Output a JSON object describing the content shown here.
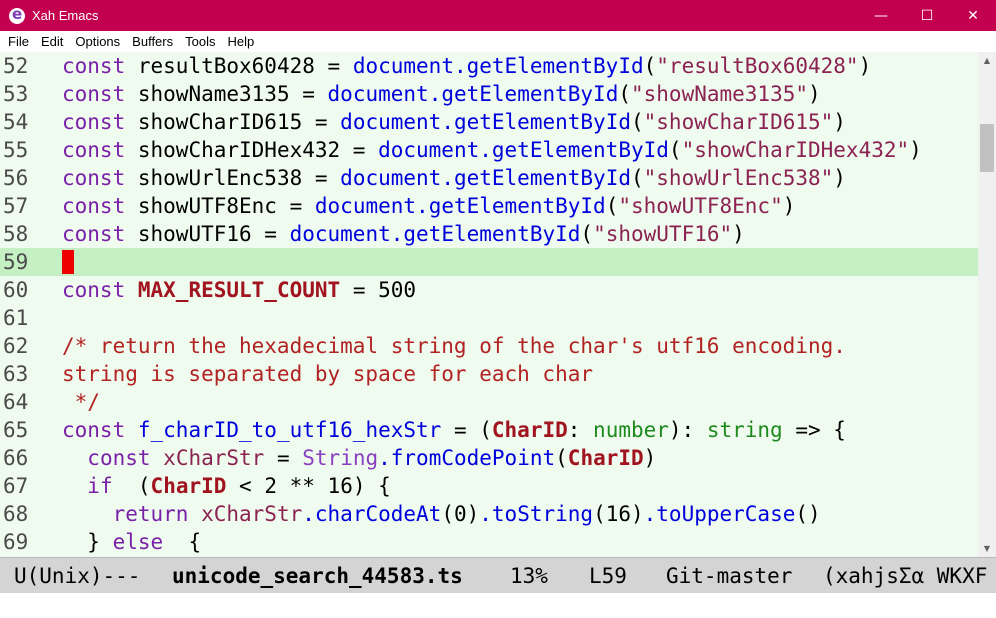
{
  "window": {
    "title": "Xah Emacs",
    "minimize_glyph": "—",
    "maximize_glyph": "☐",
    "close_glyph": "✕",
    "icon": "emacs-icon"
  },
  "menu": [
    "File",
    "Edit",
    "Options",
    "Buffers",
    "Tools",
    "Help"
  ],
  "editor": {
    "lines": [
      {
        "n": "52",
        "tokens": [
          [
            "kw",
            "const"
          ],
          [
            "",
            "resultBox60428 = "
          ],
          [
            "fn",
            "document"
          ],
          [
            "",
            ""
          ],
          [
            "fn",
            ".getElementById"
          ],
          [
            "",
            "("
          ],
          [
            "str",
            "\"resultBox60428\""
          ],
          [
            "",
            ")"
          ]
        ]
      },
      {
        "n": "53",
        "tokens": [
          [
            "kw",
            "const"
          ],
          [
            "",
            "showName3135 = "
          ],
          [
            "fn",
            "document"
          ],
          [
            "fn",
            ".getElementById"
          ],
          [
            "",
            "("
          ],
          [
            "str",
            "\"showName3135\""
          ],
          [
            "",
            ")"
          ]
        ]
      },
      {
        "n": "54",
        "tokens": [
          [
            "kw",
            "const"
          ],
          [
            "",
            "showCharID615 = "
          ],
          [
            "fn",
            "document"
          ],
          [
            "fn",
            ".getElementById"
          ],
          [
            "",
            "("
          ],
          [
            "str",
            "\"showCharID615\""
          ],
          [
            "",
            ")"
          ]
        ]
      },
      {
        "n": "55",
        "tokens": [
          [
            "kw",
            "const"
          ],
          [
            "",
            "showCharIDHex432 = "
          ],
          [
            "fn",
            "document"
          ],
          [
            "fn",
            ".getElementById"
          ],
          [
            "",
            "("
          ],
          [
            "str",
            "\"showCharIDHex432\""
          ],
          [
            "",
            ")"
          ]
        ]
      },
      {
        "n": "56",
        "tokens": [
          [
            "kw",
            "const"
          ],
          [
            "",
            "showUrlEnc538 = "
          ],
          [
            "fn",
            "document"
          ],
          [
            "fn",
            ".getElementById"
          ],
          [
            "",
            "("
          ],
          [
            "str",
            "\"showUrlEnc538\""
          ],
          [
            "",
            ")"
          ]
        ]
      },
      {
        "n": "57",
        "tokens": [
          [
            "kw",
            "const"
          ],
          [
            "",
            "showUTF8Enc = "
          ],
          [
            "fn",
            "document"
          ],
          [
            "fn",
            ".getElementById"
          ],
          [
            "",
            "("
          ],
          [
            "str",
            "\"showUTF8Enc\""
          ],
          [
            "",
            ")"
          ]
        ]
      },
      {
        "n": "58",
        "tokens": [
          [
            "kw",
            "const"
          ],
          [
            "",
            "showUTF16 = "
          ],
          [
            "fn",
            "document"
          ],
          [
            "fn",
            ".getElementById"
          ],
          [
            "",
            "("
          ],
          [
            "str",
            "\"showUTF16\""
          ],
          [
            "",
            ")"
          ]
        ]
      },
      {
        "n": "59",
        "tokens": []
      },
      {
        "n": "60",
        "tokens": [
          [
            "kw",
            "const"
          ],
          [
            "",
            ""
          ],
          [
            "cst",
            "MAX_RESULT_COUNT"
          ],
          [
            "",
            " = 500"
          ]
        ]
      },
      {
        "n": "61",
        "tokens": []
      },
      {
        "n": "62",
        "tokens": [
          [
            "cmt",
            "/* return the hexadecimal string of the char's utf16 encoding."
          ]
        ]
      },
      {
        "n": "63",
        "tokens": [
          [
            "cmt",
            "string is separated by space for each char"
          ]
        ]
      },
      {
        "n": "64",
        "tokens": [
          [
            "cmt",
            " */"
          ]
        ]
      },
      {
        "n": "65",
        "tokens": [
          [
            "kw",
            "const"
          ],
          [
            "fn",
            "f_charID_to_utf16_hexStr"
          ],
          [
            "",
            " = ("
          ],
          [
            "cst",
            "CharID"
          ],
          [
            "",
            ": "
          ],
          [
            "ty",
            "number"
          ],
          [
            "",
            "): "
          ],
          [
            "ty",
            "string"
          ],
          [
            "",
            " => {"
          ]
        ]
      },
      {
        "n": "66",
        "tokens": [
          [
            "",
            "  "
          ],
          [
            "kw",
            "const"
          ],
          [
            "str",
            "xCharStr"
          ],
          [
            "",
            " = "
          ],
          [
            "builtin",
            "String"
          ],
          [
            "fn",
            ".fromCodePoint"
          ],
          [
            "",
            "("
          ],
          [
            "cst",
            "CharID"
          ],
          [
            "",
            ")"
          ]
        ]
      },
      {
        "n": "67",
        "tokens": [
          [
            "",
            "  "
          ],
          [
            "kw",
            "if"
          ],
          [
            "",
            " ("
          ],
          [
            "cst",
            "CharID"
          ],
          [
            "",
            " < 2 ** 16) {"
          ]
        ]
      },
      {
        "n": "68",
        "tokens": [
          [
            "",
            "    "
          ],
          [
            "kw",
            "return"
          ],
          [
            "str",
            "xCharStr"
          ],
          [
            "fn",
            ".charCodeAt"
          ],
          [
            "",
            "(0)"
          ],
          [
            "fn",
            ".toString"
          ],
          [
            "",
            "(16)"
          ],
          [
            "fn",
            ".toUpperCase"
          ],
          [
            "",
            "()"
          ]
        ]
      },
      {
        "n": "69",
        "tokens": [
          [
            "",
            "  } "
          ],
          [
            "kw",
            "else"
          ],
          [
            "",
            " {"
          ]
        ]
      }
    ],
    "current_line": "59"
  },
  "modeline": {
    "encoding": "U(Unix)---",
    "buffer": "unicode_search_44583.ts",
    "percent": "13%",
    "line": "L59",
    "vc": "Git-master",
    "modes": "(xahjsΣα WKXF"
  },
  "colors": {
    "titlebar": "#c2004f",
    "editor_bg": "#eefbee",
    "current_line_bg": "#c4f0c4",
    "cursor": "#ee0000",
    "keyword": "#7a20a8",
    "function": "#0000dd",
    "string": "#8b2252",
    "comment": "#b22222",
    "constant": "#a0131f",
    "type": "#1d8a1d"
  }
}
